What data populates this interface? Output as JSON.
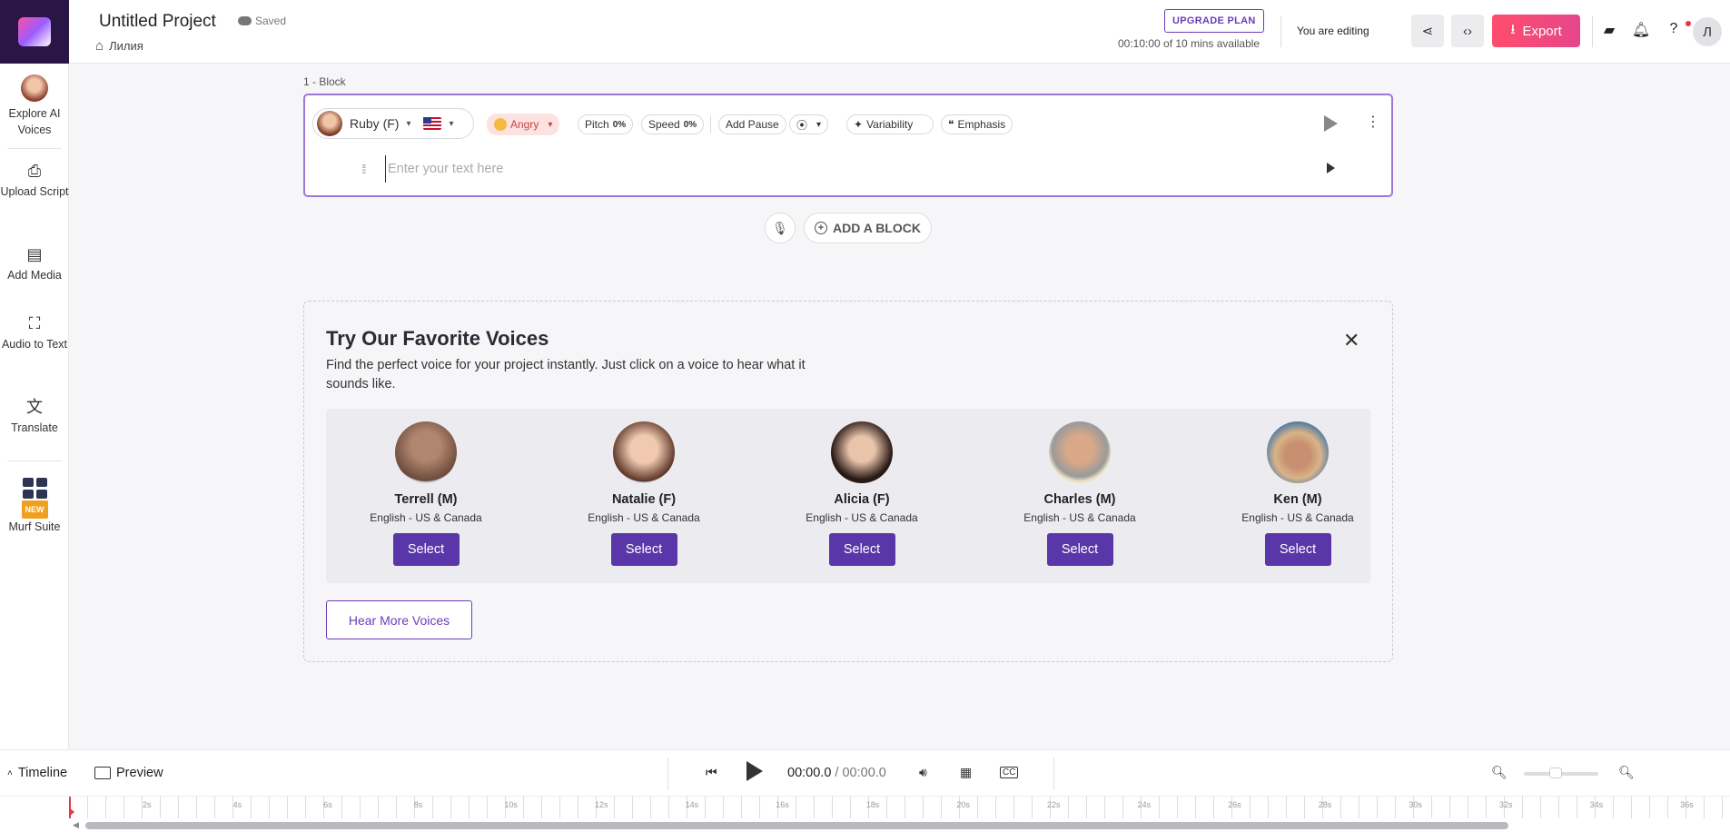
{
  "header": {
    "project_title": "Untitled Project",
    "saved_label": "Saved",
    "breadcrumb": "Лилия",
    "upgrade_label": "UPGRADE PLAN",
    "minutes_available": "00:10:00 of 10 mins available",
    "editing_label": "You are editing",
    "export_label": "Export",
    "user_initial": "Л"
  },
  "sidebar": {
    "items": [
      {
        "label": "Explore AI Voices"
      },
      {
        "label": "Upload Script"
      },
      {
        "label": "Add Media"
      },
      {
        "label": "Audio to Text"
      },
      {
        "label": "Translate"
      },
      {
        "label": "Murf Suite",
        "badge": "NEW"
      }
    ]
  },
  "block": {
    "label": "1 -  Block",
    "voice_name": "Ruby (F)",
    "style": "Angry",
    "pitch_label": "Pitch",
    "pitch_value": "0%",
    "speed_label": "Speed",
    "speed_value": "0%",
    "add_pause_label": "Add Pause",
    "variability_label": "Variability",
    "emphasis_label": "Emphasis",
    "text_placeholder": "Enter your text here"
  },
  "add_block_label": "ADD A BLOCK",
  "favorites": {
    "title": "Try Our Favorite Voices",
    "subtitle": "Find the perfect voice for your project instantly. Just click on a voice to hear what it sounds like.",
    "voices": [
      {
        "name": "Terrell (M)",
        "lang": "English - US & Canada",
        "select": "Select",
        "color": "#6b4a3a"
      },
      {
        "name": "Natalie (F)",
        "lang": "English - US & Canada",
        "select": "Select",
        "color": "#b88a70"
      },
      {
        "name": "Alicia (F)",
        "lang": "English - US & Canada",
        "select": "Select",
        "color": "#3a2a26"
      },
      {
        "name": "Charles (M)",
        "lang": "English - US & Canada",
        "select": "Select",
        "color": "#d8c7a8"
      },
      {
        "name": "Ken (M)",
        "lang": "English - US & Canada",
        "select": "Select",
        "color": "#6a8aa8"
      }
    ],
    "hear_more_label": "Hear More Voices"
  },
  "bottom": {
    "timeline_label": "Timeline",
    "preview_label": "Preview",
    "time_current": "00:00.0",
    "time_separator": " / ",
    "time_total": "00:00.0"
  },
  "ruler": {
    "ticks": [
      "2s",
      "4s",
      "6s",
      "8s",
      "10s",
      "12s",
      "14s",
      "16s",
      "18s",
      "20s",
      "22s",
      "24s",
      "26s",
      "28s",
      "30s",
      "32s",
      "34s",
      "36s"
    ]
  },
  "colors": {
    "accent": "#5a37a8",
    "export_gradient_start": "#ff4d6d",
    "block_border": "#9b78d6"
  }
}
